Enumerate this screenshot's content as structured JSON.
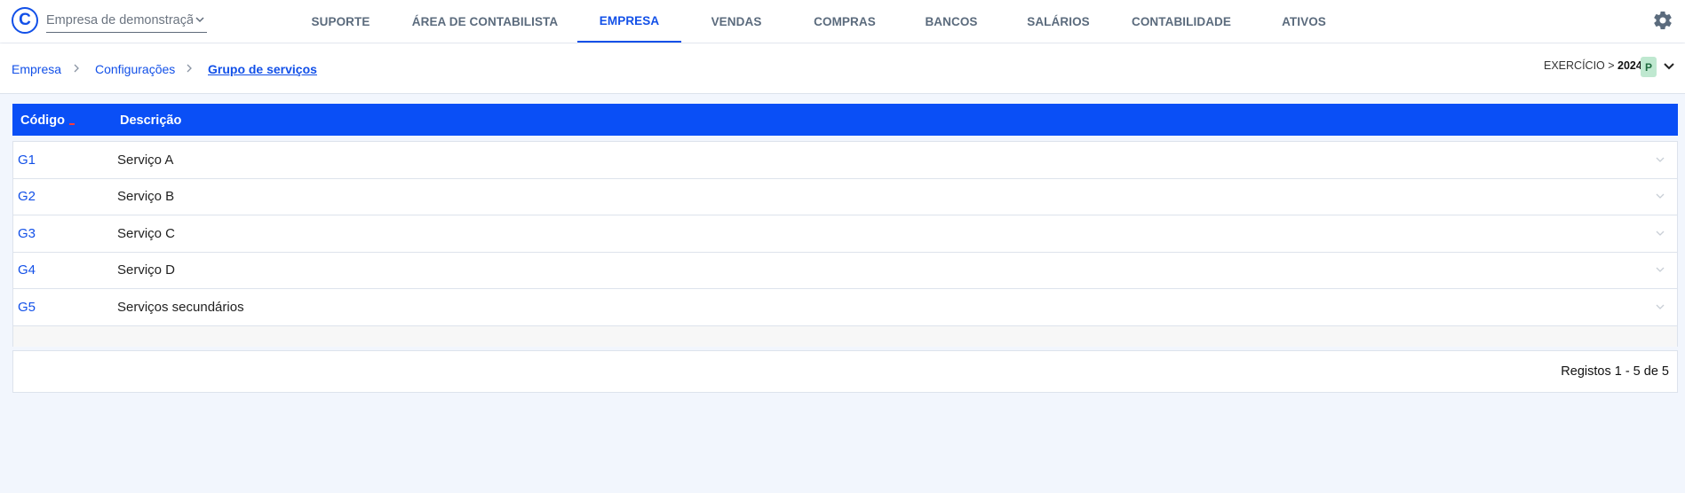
{
  "app": {
    "logo_letter": "C"
  },
  "company_select": {
    "value": "Empresa de demonstração",
    "display": "Empresa de demonstraçã..."
  },
  "nav": {
    "items": [
      {
        "label": "SUPORTE",
        "active": false
      },
      {
        "label": "ÁREA DE CONTABILISTA",
        "active": false
      },
      {
        "label": "EMPRESA",
        "active": true
      },
      {
        "label": "VENDAS",
        "active": false
      },
      {
        "label": "COMPRAS",
        "active": false
      },
      {
        "label": "BANCOS",
        "active": false
      },
      {
        "label": "SALÁRIOS",
        "active": false
      },
      {
        "label": "CONTABILIDADE",
        "active": false
      },
      {
        "label": "ATIVOS",
        "active": false
      }
    ],
    "settings_icon": "gear-icon"
  },
  "breadcrumb": {
    "items": [
      "Empresa",
      "Configurações",
      "Grupo de serviços"
    ],
    "separator_icon": "chevron-right-icon"
  },
  "exercise": {
    "label": "EXERCÍCIO > ",
    "year": "2024",
    "status": "P"
  },
  "table": {
    "columns": [
      "Código",
      "Descrição"
    ],
    "rows": [
      {
        "code": "G1",
        "description": "Serviço A"
      },
      {
        "code": "G2",
        "description": "Serviço B"
      },
      {
        "code": "G3",
        "description": "Serviço C"
      },
      {
        "code": "G4",
        "description": "Serviço D"
      },
      {
        "code": "G5",
        "description": "Serviços secundários"
      }
    ]
  },
  "pagination": {
    "text": "Registos 1 - 5 de 5"
  },
  "colors": {
    "accent": "#1250e8",
    "header_bg": "#0a4ff6",
    "page_bg": "#f2f6fd",
    "badge_bg": "#bfe8d0"
  }
}
